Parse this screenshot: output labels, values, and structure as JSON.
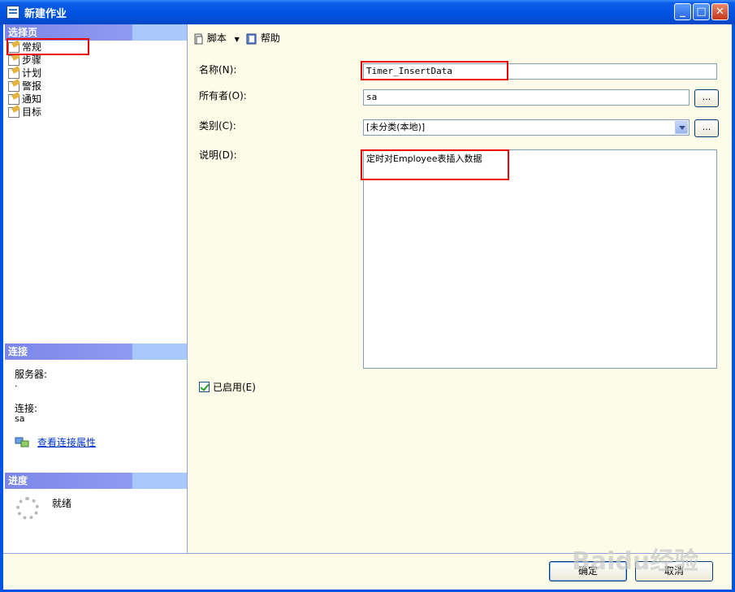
{
  "window": {
    "title": "新建作业",
    "icon": "sql-agent-job-icon"
  },
  "title_buttons": {
    "minimize": "_",
    "maximize": "□",
    "close": "✕"
  },
  "sidebar": {
    "select_page_header": "选择页",
    "pages": [
      {
        "label": "常规",
        "icon": "page-icon"
      },
      {
        "label": "步骤",
        "icon": "page-icon"
      },
      {
        "label": "计划",
        "icon": "page-icon"
      },
      {
        "label": "警报",
        "icon": "page-icon"
      },
      {
        "label": "通知",
        "icon": "page-icon"
      },
      {
        "label": "目标",
        "icon": "page-icon"
      }
    ],
    "connection": {
      "header": "连接",
      "server_label": "服务器:",
      "server_value": ".",
      "conn_label": "连接:",
      "conn_value": "sa",
      "view_props_link": "查看连接属性"
    },
    "progress": {
      "header": "进度",
      "status": "就绪"
    }
  },
  "toolbar": {
    "script_label": "脚本",
    "help_label": "帮助"
  },
  "form": {
    "name_label": "名称(N):",
    "name_value": "Timer_InsertData",
    "owner_label": "所有者(O):",
    "owner_value": "sa",
    "category_label": "类别(C):",
    "category_value": "[未分类(本地)]",
    "description_label": "说明(D):",
    "description_value": "定时对Employee表插入数据",
    "enabled_label": "已启用(E)",
    "enabled": true,
    "ellipsis": "..."
  },
  "buttons": {
    "ok": "确定",
    "cancel": "取消"
  },
  "watermark": "Baidu经验",
  "colors": {
    "highlight": "#ee0000",
    "section_header": "#7b86e8",
    "panel_bg": "#fcfce8"
  }
}
